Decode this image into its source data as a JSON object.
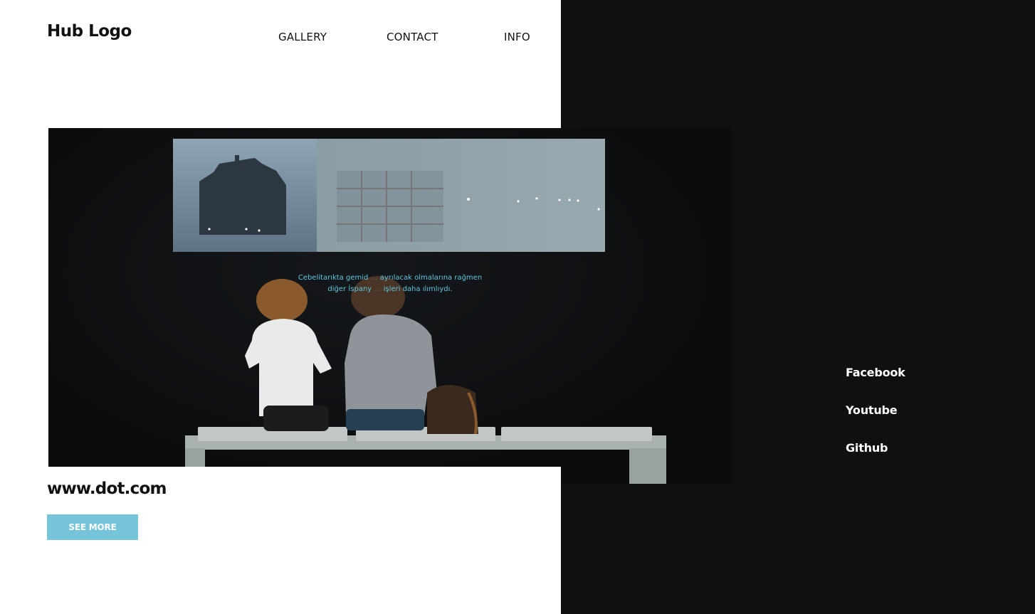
{
  "header": {
    "logo": "Hub Logo",
    "nav": {
      "gallery": "GALLERY",
      "contact": "CONTACT",
      "info": "INFO"
    }
  },
  "hero": {
    "subtitle_line1": "Cebelitarıkta gemid",
    "subtitle_line1_b": "ayrılacak olmalarına rağmen",
    "subtitle_line2": "diğer İspany",
    "subtitle_line2_b": "işleri daha ılımlıydı."
  },
  "content": {
    "site_name": "www.dot.com",
    "see_more_label": "SEE MORE"
  },
  "social": {
    "facebook": "Facebook",
    "youtube": "Youtube",
    "github": "Github"
  },
  "colors": {
    "accent": "#75c4d9",
    "dark_panel": "#0f1012",
    "subtitle_text": "#5fc6df"
  }
}
